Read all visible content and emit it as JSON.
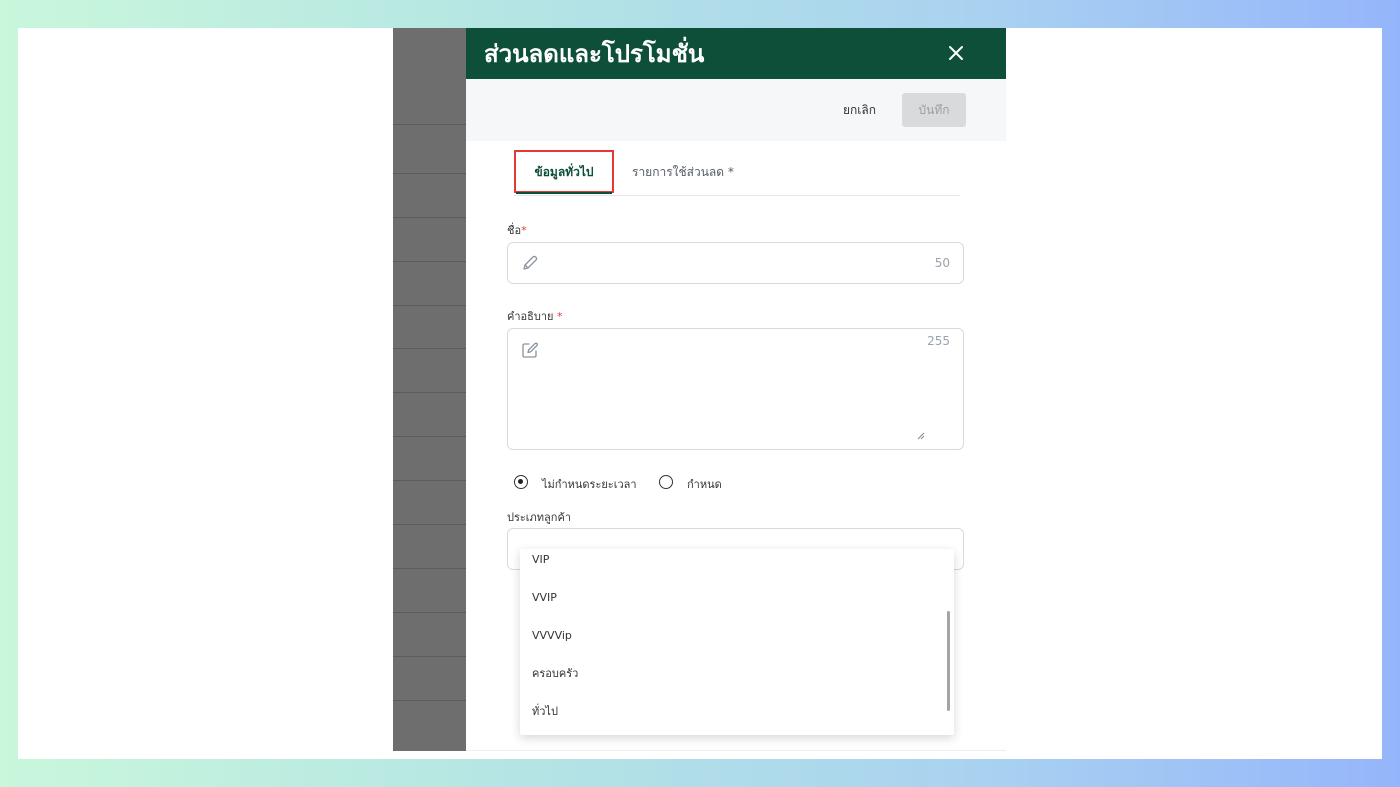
{
  "drawer": {
    "title": "ส่วนลดและโปรโมชั่น",
    "close_icon": "close-icon"
  },
  "actions": {
    "cancel_label": "ยกเลิก",
    "save_label": "บันทึก",
    "save_disabled": true
  },
  "tabs": [
    {
      "label": "ข้อมูลทั่วไป",
      "active": true
    },
    {
      "label": "รายการใช้ส่วนลด *",
      "active": false
    }
  ],
  "form": {
    "name": {
      "label": "ชื่อ",
      "required_mark": "*",
      "value": "",
      "max_length": "50",
      "icon": "pencil-icon"
    },
    "description": {
      "label": "คำอธิบาย",
      "required_mark": "*",
      "value": "",
      "max_length": "255",
      "icon": "edit-square-icon"
    },
    "period": {
      "options": [
        {
          "label": "ไม่กำหนดระยะเวลา",
          "checked": true
        },
        {
          "label": "กำหนด",
          "checked": false
        }
      ]
    },
    "customer_type": {
      "label": "ประเภทลูกค้า",
      "value": "",
      "dropdown_open": true,
      "options": [
        "VIP",
        "VVIP",
        "VVVVip",
        "ครอบครัว",
        "ทั่วไป"
      ]
    }
  },
  "colors": {
    "header_bg": "#0e4f39",
    "accent_green": "#0e4f39",
    "required_red": "#e53935",
    "highlight_box": "#e53935",
    "save_disabled_bg": "#d9dadc",
    "backdrop_gray": "#6e6e6e"
  }
}
